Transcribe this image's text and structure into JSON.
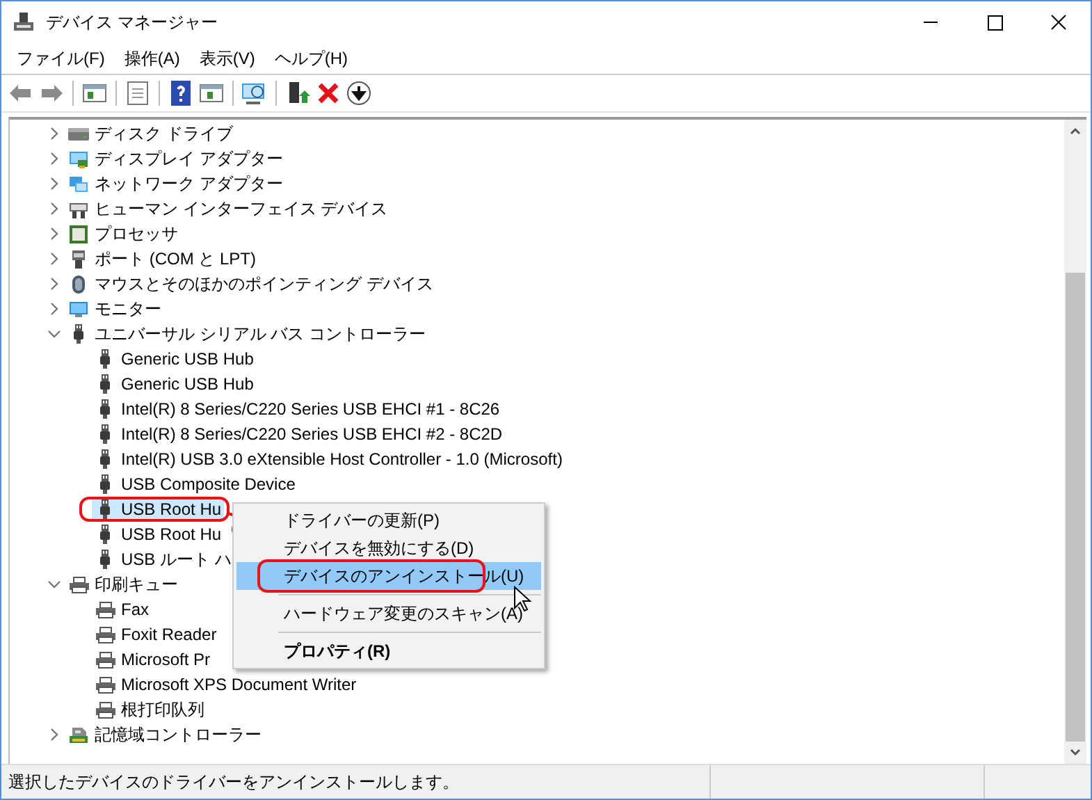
{
  "window": {
    "title": "デバイス マネージャー"
  },
  "menu_bar": [
    "ファイル(F)",
    "操作(A)",
    "表示(V)",
    "ヘルプ(H)"
  ],
  "tree": [
    {
      "label": "ディスク ドライブ",
      "kind": "disk",
      "expanded": false,
      "selected": false
    },
    {
      "label": "ディスプレイ アダプター",
      "kind": "display",
      "expanded": false,
      "selected": false
    },
    {
      "label": "ネットワーク アダプター",
      "kind": "network",
      "expanded": false,
      "selected": false
    },
    {
      "label": "ヒューマン インターフェイス デバイス",
      "kind": "hid",
      "expanded": false,
      "selected": false
    },
    {
      "label": "プロセッサ",
      "kind": "cpu",
      "expanded": false,
      "selected": false
    },
    {
      "label": "ポート (COM と LPT)",
      "kind": "port",
      "expanded": false,
      "selected": false
    },
    {
      "label": "マウスとそのほかのポインティング デバイス",
      "kind": "mouse",
      "expanded": false,
      "selected": false
    },
    {
      "label": "モニター",
      "kind": "monitor",
      "expanded": false,
      "selected": false
    },
    {
      "label": "ユニバーサル シリアル バス コントローラー",
      "kind": "usb",
      "expanded": true,
      "selected": false,
      "children": [
        {
          "label": "Generic USB Hub",
          "kind": "usb",
          "selected": false
        },
        {
          "label": "Generic USB Hub",
          "kind": "usb",
          "selected": false
        },
        {
          "label": "Intel(R) 8 Series/C220 Series USB EHCI #1 - 8C26",
          "kind": "usb",
          "selected": false
        },
        {
          "label": "Intel(R) 8 Series/C220 Series USB EHCI #2 - 8C2D",
          "kind": "usb",
          "selected": false
        },
        {
          "label": "Intel(R) USB 3.0 eXtensible Host Controller - 1.0 (Microsoft)",
          "kind": "usb",
          "selected": false
        },
        {
          "label": "USB Composite Device",
          "kind": "usb",
          "selected": false
        },
        {
          "label": "USB Root Hu",
          "kind": "usb",
          "selected": true
        },
        {
          "label": "USB Root Hu",
          "kind": "usb",
          "selected": false
        },
        {
          "label": "USB ルート ハ",
          "kind": "usb",
          "selected": false
        }
      ]
    },
    {
      "label": "印刷キュー",
      "kind": "printer",
      "expanded": true,
      "selected": false,
      "children": [
        {
          "label": "Fax",
          "kind": "printer",
          "selected": false
        },
        {
          "label": "Foxit Reader",
          "kind": "printer",
          "selected": false
        },
        {
          "label": "Microsoft Pr",
          "kind": "printer",
          "selected": false
        },
        {
          "label": "Microsoft XPS Document Writer",
          "kind": "printer",
          "selected": false
        },
        {
          "label": "根打印队列",
          "kind": "printer",
          "selected": false
        }
      ]
    },
    {
      "label": "記憶域コントローラー",
      "kind": "storage",
      "expanded": false,
      "selected": false
    }
  ],
  "context_menu": [
    {
      "kind": "item",
      "label": "ドライバーの更新(P)",
      "selected": false,
      "default": false
    },
    {
      "kind": "item",
      "label": "デバイスを無効にする(D)",
      "selected": false,
      "default": false
    },
    {
      "kind": "item",
      "label": "デバイスのアンインストール(U)",
      "selected": true,
      "default": false
    },
    {
      "kind": "separator"
    },
    {
      "kind": "item",
      "label": "ハードウェア変更のスキャン(A)",
      "selected": false,
      "default": false
    },
    {
      "kind": "separator"
    },
    {
      "kind": "item",
      "label": "プロパティ(R)",
      "selected": false,
      "default": true
    }
  ],
  "status_bar": {
    "text": "選択したデバイスのドライバーをアンインストールします。"
  }
}
